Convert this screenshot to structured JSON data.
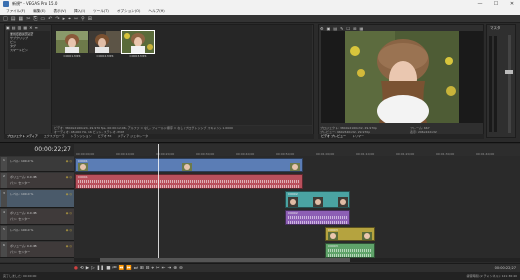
{
  "title": {
    "text": "新規* - VEGAS Pro 15.0"
  },
  "window_controls": [
    "—",
    "☐",
    "✕"
  ],
  "menu": [
    "ファイル(F)",
    "編集(E)",
    "表示(V)",
    "挿入(I)",
    "ツール(T)",
    "オプション(O)",
    "ヘルプ(H)"
  ],
  "toolbar_icons": [
    "□",
    "▤",
    "▦",
    "✂",
    "⎘",
    "▭",
    "↶",
    "↷",
    "▸",
    "⌖",
    "⇿",
    "⚲",
    "⊞"
  ],
  "explorer": {
    "head_icons": [
      "▣",
      "▤",
      "▥",
      "▦",
      "✕",
      "≡"
    ],
    "tree": [
      "すべてのメディア",
      "サブクリップ",
      "ビン",
      "タグ",
      "スマートビン"
    ],
    "thumbs": [
      {
        "label": "C0001.MP4"
      },
      {
        "label": "C0002.MP4"
      },
      {
        "label": "C0003.MP4"
      }
    ],
    "info_lines": [
      "ビデオ: 3840x2160x24, 29.970 fps, 00:00:12;06, アルファ = なし, フィールド順序 = なし (プログレッシブ スキャン), 1.0000",
      "オーディオ: 48,000 Hz, 16 ビット, ステレオ, PCM"
    ],
    "tabs": [
      "プロジェクト メディア",
      "エクスプローラ",
      "トランジション",
      "ビデオ FX",
      "メディア ジェネレータ"
    ]
  },
  "preview": {
    "head_label": "ビデオ プレビュー",
    "head_icons": [
      "⚙",
      "▣",
      "▤",
      "✎",
      "☐",
      "⊞",
      "▦"
    ],
    "info_left": [
      "プロジェクト: 3840x2160x32, 29.970p",
      "プレビュー: 960x540x32, 29.970p"
    ],
    "info_right": [
      "フレーム: 667",
      "表示: 296x222x32"
    ],
    "tabs": [
      "ビデオ プレビュー",
      "トリマー"
    ]
  },
  "master": {
    "label": "マスタ",
    "scale": [
      "3",
      "6",
      "9",
      "12",
      "15",
      "18",
      "21",
      "24",
      "27",
      "30",
      "33",
      "36",
      "39",
      "42",
      "45",
      "48",
      "51",
      "54",
      "57"
    ]
  },
  "timeline": {
    "time": "00:00:22;27",
    "ticks": [
      "00:00:00;00",
      "00:00:10;00",
      "00:00:20;00",
      "00:00:30;00",
      "00:00:40;00",
      "00:00:50;00",
      "00:01:00;00",
      "00:01:10;00",
      "00:01:20;00",
      "00:01:30;00",
      "00:01:40;00"
    ],
    "tracks": [
      {
        "num": "1",
        "label": "レベル:",
        "value": "100.0 %"
      },
      {
        "num": "2",
        "label": "ボリューム:",
        "value": "0.0 dB",
        "label2": "パン:",
        "value2": "センター"
      },
      {
        "num": "3",
        "label": "レベル:",
        "value": "100.0 %"
      },
      {
        "num": "4",
        "label": "ボリューム:",
        "value": "0.0 dB",
        "label2": "パン:",
        "value2": "センター"
      },
      {
        "num": "5",
        "label": "レベル:",
        "value": "100.0 %"
      },
      {
        "num": "6",
        "label": "ボリューム:",
        "value": "0.0 dB",
        "label2": "パン:",
        "value2": "センター"
      }
    ],
    "clips": [
      {
        "name": "C0001",
        "kind": "video",
        "color": "#5b7db5"
      },
      {
        "name": "C0001",
        "kind": "audio",
        "color": "#b9505c"
      },
      {
        "name": "C0002",
        "kind": "video",
        "color": "#4aa3a2"
      },
      {
        "name": "C0002",
        "kind": "audio",
        "color": "#8d5fb5"
      },
      {
        "name": "C0003",
        "kind": "video",
        "color": "#b5a33f"
      },
      {
        "name": "C0003",
        "kind": "audio",
        "color": "#5fa36a"
      }
    ]
  },
  "transport": {
    "rate": "レート: 0.00",
    "buttons": [
      "●",
      "⟲",
      "▶",
      "▷",
      "❚❚",
      "■",
      "⏮",
      "⏪",
      "⏩",
      "⏭",
      "⊞",
      "⊟",
      "⌖",
      "✂",
      "⇤",
      "⇥",
      "⊕",
      "⊖"
    ],
    "right_time": "00:00:22;27"
  },
  "status": {
    "left": "完了しました: 00:00:00",
    "right": "録音時間 (2 チャンネル): 121:36:40"
  }
}
